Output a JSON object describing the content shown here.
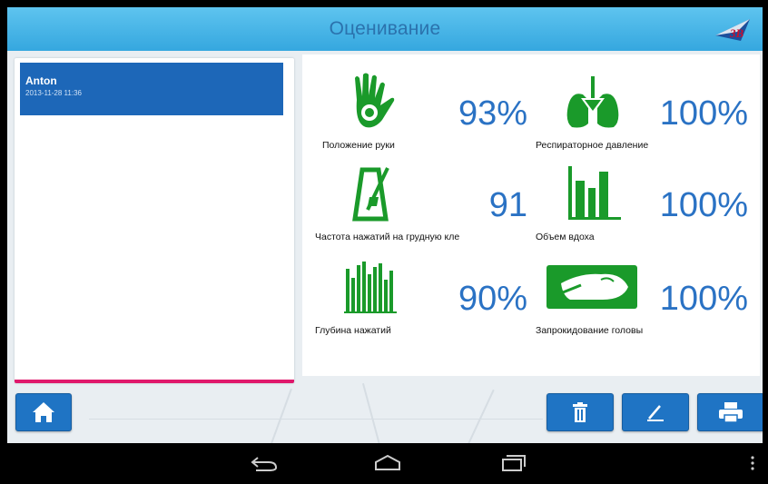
{
  "header": {
    "title": "Оценивание",
    "logo_icon": "3b-logo-icon"
  },
  "list": {
    "items": [
      {
        "name": "Anton",
        "date": "2013-11-28 11:36"
      }
    ]
  },
  "metrics": [
    {
      "label": "Положение руки",
      "value": "93%",
      "icon": "hand-icon"
    },
    {
      "label": "Респираторное давление",
      "value": "100%",
      "icon": "lungs-icon"
    },
    {
      "label": "Частота нажатий на грудную кле",
      "value": "91",
      "icon": "metronome-icon"
    },
    {
      "label": "Объем вдоха",
      "value": "100%",
      "icon": "volume-bars-icon"
    },
    {
      "label": "Глубина нажатий",
      "value": "90%",
      "icon": "depth-bars-icon"
    },
    {
      "label": "Запрокидование головы",
      "value": "100%",
      "icon": "head-tilt-icon"
    }
  ],
  "toolbar": {
    "home_icon": "home-icon",
    "delete_icon": "trash-icon",
    "edit_icon": "pen-icon",
    "print_icon": "printer-icon"
  },
  "navbar": {
    "back_icon": "back-icon",
    "home_icon": "home-outline-icon",
    "recents_icon": "recents-icon",
    "menu_icon": "menu-dots-icon"
  },
  "colors": {
    "accent": "#1f74c4",
    "icon_green": "#1a9a2a",
    "value_blue": "#2a72c4",
    "highlight": "#e0186c"
  }
}
